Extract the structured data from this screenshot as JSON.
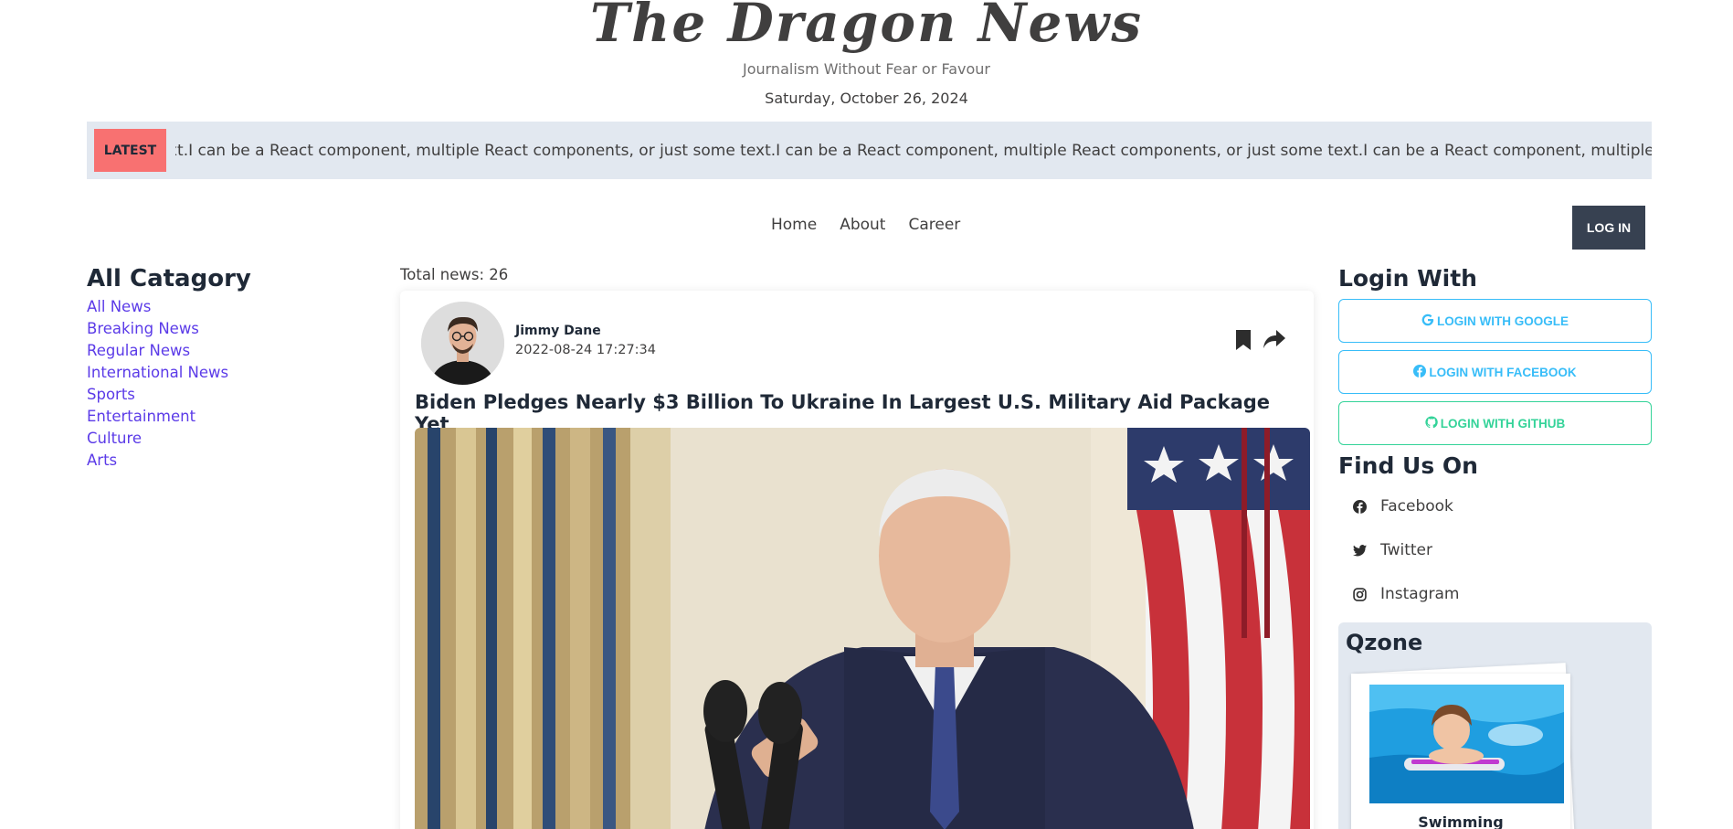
{
  "header": {
    "site_title": "The Dragon News",
    "tagline": "Journalism Without Fear or Favour",
    "date": "Saturday, October 26, 2024"
  },
  "latest": {
    "badge": "LATEST",
    "ticker": "xt.I can be a React component, multiple React components, or just some text.I can be a React component, multiple React components, or just some text.I can be a React component, multiple React components, or just some text."
  },
  "nav": {
    "items": [
      "Home",
      "About",
      "Career"
    ],
    "login_label": "LOG IN"
  },
  "categories": {
    "title": "All Catagory",
    "items": [
      "All News",
      "Breaking News",
      "Regular News",
      "International News",
      "Sports",
      "Entertainment",
      "Culture",
      "Arts"
    ]
  },
  "main": {
    "total_news": "Total news: 26",
    "card": {
      "author": "Jimmy Dane",
      "published": "2022-08-24 17:27:34",
      "title": "Biden Pledges Nearly $3 Billion To Ukraine In Largest U.S. Military Aid Package Yet"
    }
  },
  "sidebar": {
    "login_title": "Login With",
    "google": "LOGIN WITH GOOGLE",
    "facebook": "LOGIN WITH FACEBOOK",
    "github": "LOGIN WITH GITHUB",
    "find_title": "Find Us On",
    "socials": [
      "Facebook",
      "Twitter",
      "Instagram"
    ],
    "qzone_title": "Qzone",
    "qzone_caption": "Swimming"
  },
  "colors": {
    "accent_purple": "#5b3be8",
    "badge_red": "#f87171",
    "login_dark": "#374151",
    "ticker_bg": "#e2e8f0",
    "social_blue": "#38bdf8",
    "social_green": "#34d399"
  },
  "icons": [
    "bookmark-icon",
    "share-icon",
    "google-icon",
    "facebook-icon",
    "github-icon",
    "twitter-icon",
    "instagram-icon"
  ]
}
